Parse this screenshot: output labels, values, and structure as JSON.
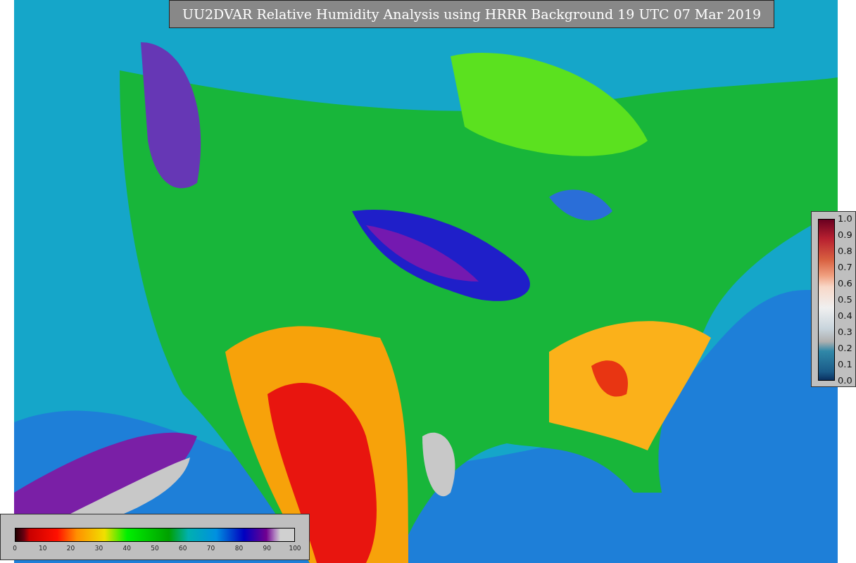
{
  "title": "UU2DVAR Relative Humidity Analysis using HRRR Background 19 UTC 07 Mar 2019",
  "humidity_colorbar": {
    "ticks": [
      "0",
      "10",
      "20",
      "30",
      "40",
      "50",
      "60",
      "70",
      "80",
      "90",
      "100"
    ]
  },
  "observation_colorbar": {
    "ticks": [
      "1.0",
      "0.9",
      "0.8",
      "0.7",
      "0.6",
      "0.5",
      "0.4",
      "0.3",
      "0.2",
      "0.1",
      "0.0"
    ]
  }
}
